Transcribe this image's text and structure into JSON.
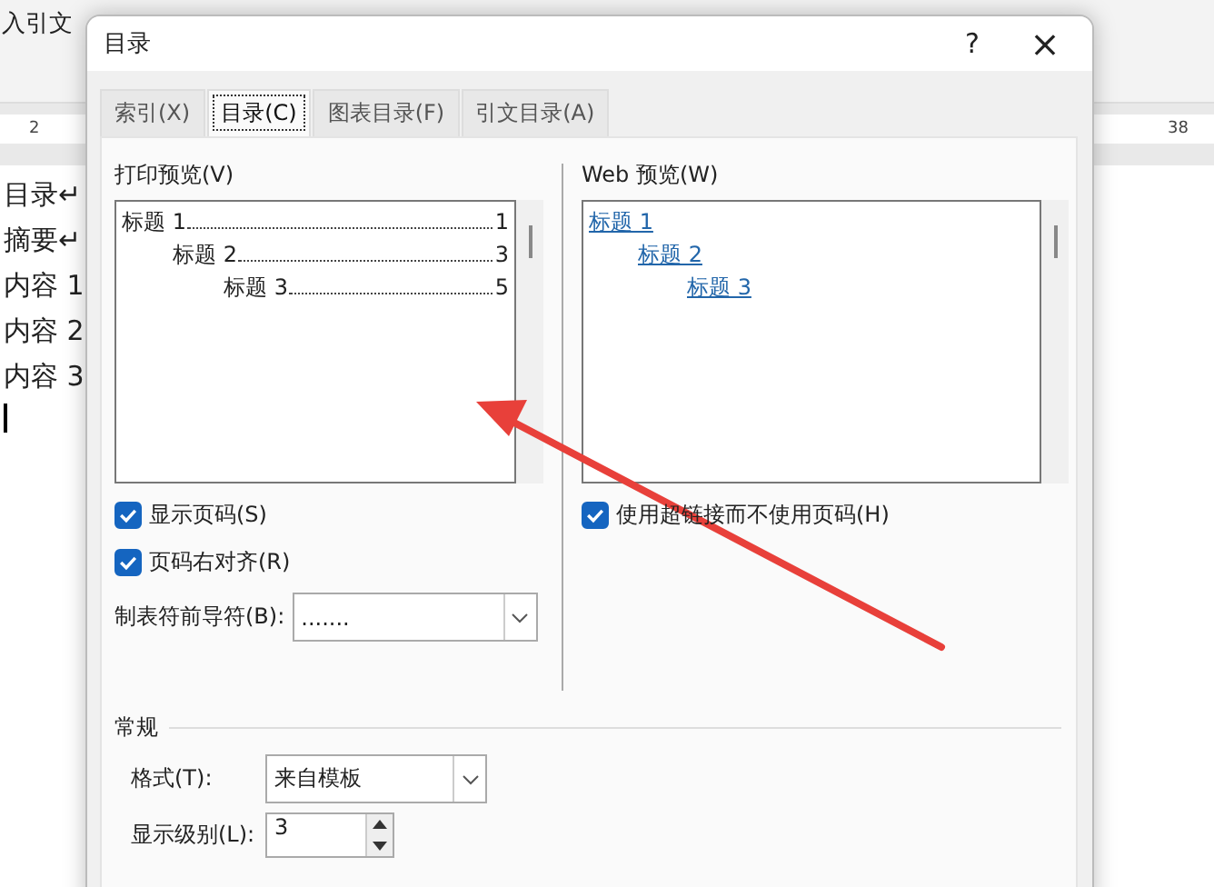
{
  "ribbon": {
    "insert_citation": "入引文"
  },
  "ruler": {
    "left_number": "2",
    "right_number": "38"
  },
  "document": {
    "lines": [
      "目录↵",
      "摘要↵",
      "内容 1",
      "内容 2",
      "内容 3"
    ]
  },
  "dialog": {
    "title": "目录",
    "help": "?",
    "close": "×",
    "tabs": [
      {
        "label": "索引(X)",
        "selected": false
      },
      {
        "label": "目录(C)",
        "selected": true
      },
      {
        "label": "图表目录(F)",
        "selected": false
      },
      {
        "label": "引文目录(A)",
        "selected": false
      }
    ],
    "print_preview": {
      "label": "打印预览(V)",
      "entries": [
        {
          "text": "标题 1",
          "page": "1",
          "children": [
            {
              "text": "标题 2",
              "page": "3",
              "children": [
                {
                  "text": "标题 3",
                  "page": "5"
                }
              ]
            }
          ]
        }
      ]
    },
    "web_preview": {
      "label": "Web 预览(W)",
      "entries": [
        {
          "text": "标题 1",
          "children": [
            {
              "text": "标题 2",
              "children": [
                {
                  "text": "标题 3"
                }
              ]
            }
          ]
        }
      ]
    },
    "show_page_numbers": {
      "label": "显示页码(S)",
      "checked": true
    },
    "right_align": {
      "label": "页码右对齐(R)",
      "checked": true
    },
    "use_hyperlinks": {
      "label": "使用超链接而不使用页码(H)",
      "checked": true
    },
    "tab_leader": {
      "label": "制表符前导符(B):",
      "value": "......."
    },
    "general": {
      "heading": "常规",
      "format_label": "格式(T):",
      "format_value": "来自模板",
      "levels_label": "显示级别(L):",
      "levels_value": "3"
    }
  }
}
